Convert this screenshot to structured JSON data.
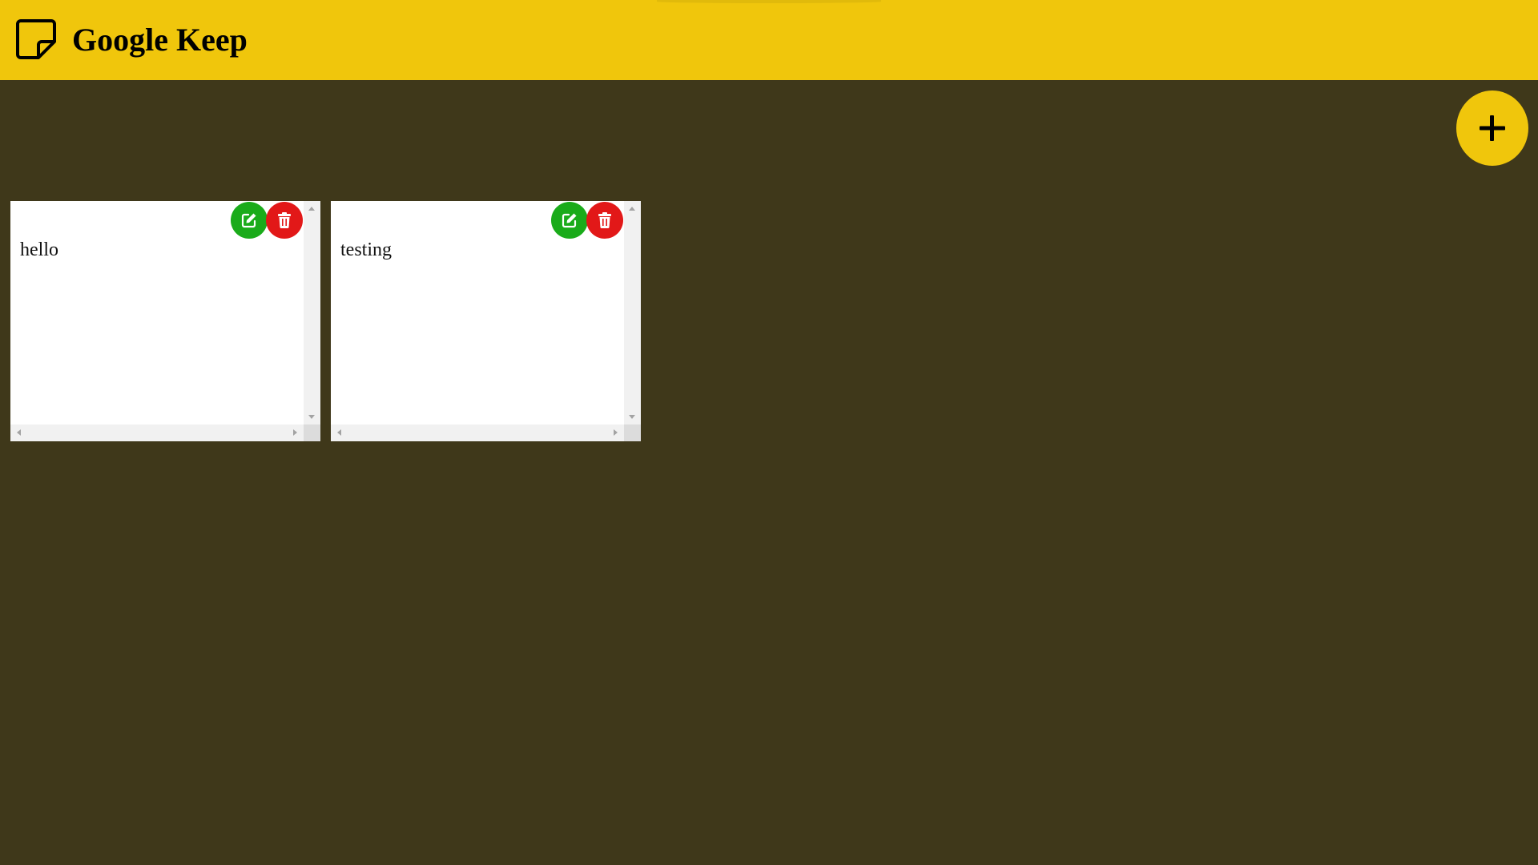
{
  "header": {
    "title": "Google Keep",
    "logo_icon": "sticky-note-icon",
    "background_color": "#f0c60c"
  },
  "add_button": {
    "icon": "plus-icon",
    "color": "#f0c60c"
  },
  "page": {
    "background_color": "#3f381a"
  },
  "notes": [
    {
      "text": "hello",
      "edit_icon": "edit-icon",
      "delete_icon": "trash-icon"
    },
    {
      "text": "testing",
      "edit_icon": "edit-icon",
      "delete_icon": "trash-icon"
    }
  ],
  "colors": {
    "edit_button": "#1aab1a",
    "delete_button": "#e21818",
    "note_background": "#ffffff"
  }
}
